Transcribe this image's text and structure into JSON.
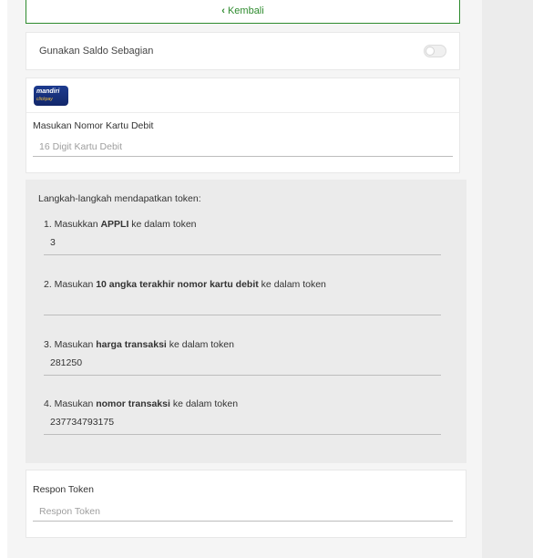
{
  "back": {
    "label": "Kembali",
    "icon": "chevron-left-icon"
  },
  "saldo": {
    "label": "Gunakan Saldo Sebagian",
    "enabled": false
  },
  "bank": {
    "logo_text": "mandiri",
    "logo_sub": "clickpay"
  },
  "card_number": {
    "label": "Masukan Nomor Kartu Debit",
    "placeholder": "16 Digit Kartu Debit",
    "value": ""
  },
  "token_steps": {
    "intro": "Langkah-langkah mendapatkan token:",
    "steps": [
      {
        "prefix": "1. Masukkan ",
        "bold": "APPLI",
        "suffix": " ke dalam token",
        "value": "3"
      },
      {
        "prefix": "2. Masukan ",
        "bold": "10 angka terakhir nomor kartu debit",
        "suffix": " ke dalam token",
        "value": ""
      },
      {
        "prefix": "3. Masukan ",
        "bold": "harga transaksi",
        "suffix": " ke dalam token",
        "value": "281250"
      },
      {
        "prefix": "4. Masukan ",
        "bold": "nomor transaksi",
        "suffix": " ke dalam token",
        "value": "237734793175"
      }
    ]
  },
  "respon_token": {
    "label": "Respon Token",
    "placeholder": "Respon Token",
    "value": ""
  },
  "colors": {
    "accent": "#2e8b2e",
    "token_bg": "#ebebeb",
    "bank_blue": "#1d3b8f"
  }
}
